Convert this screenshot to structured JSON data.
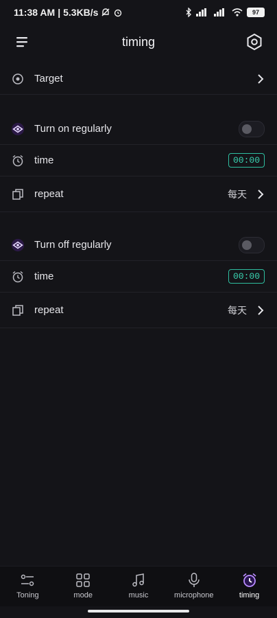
{
  "status_bar": {
    "time": "11:38 AM",
    "speed": "5.3KB/s",
    "battery": "97"
  },
  "header": {
    "title": "timing"
  },
  "target": {
    "label": "Target"
  },
  "on_section": {
    "label": "Turn on regularly",
    "enabled": false,
    "time_label": "time",
    "time_value": "00:00",
    "repeat_label": "repeat",
    "repeat_value": "每天"
  },
  "off_section": {
    "label": "Turn off regularly",
    "enabled": false,
    "time_label": "time",
    "time_value": "00:00",
    "repeat_label": "repeat",
    "repeat_value": "每天"
  },
  "nav": {
    "items": [
      {
        "label": "Toning",
        "icon": "toning-icon"
      },
      {
        "label": "mode",
        "icon": "grid-icon"
      },
      {
        "label": "music",
        "icon": "music-note-icon"
      },
      {
        "label": "microphone",
        "icon": "microphone-icon"
      },
      {
        "label": "timing",
        "icon": "alarm-clock-icon",
        "active": true
      }
    ]
  },
  "colors": {
    "accent": "#39d3b1",
    "active_icon": "#a96bff",
    "background": "#141418"
  }
}
